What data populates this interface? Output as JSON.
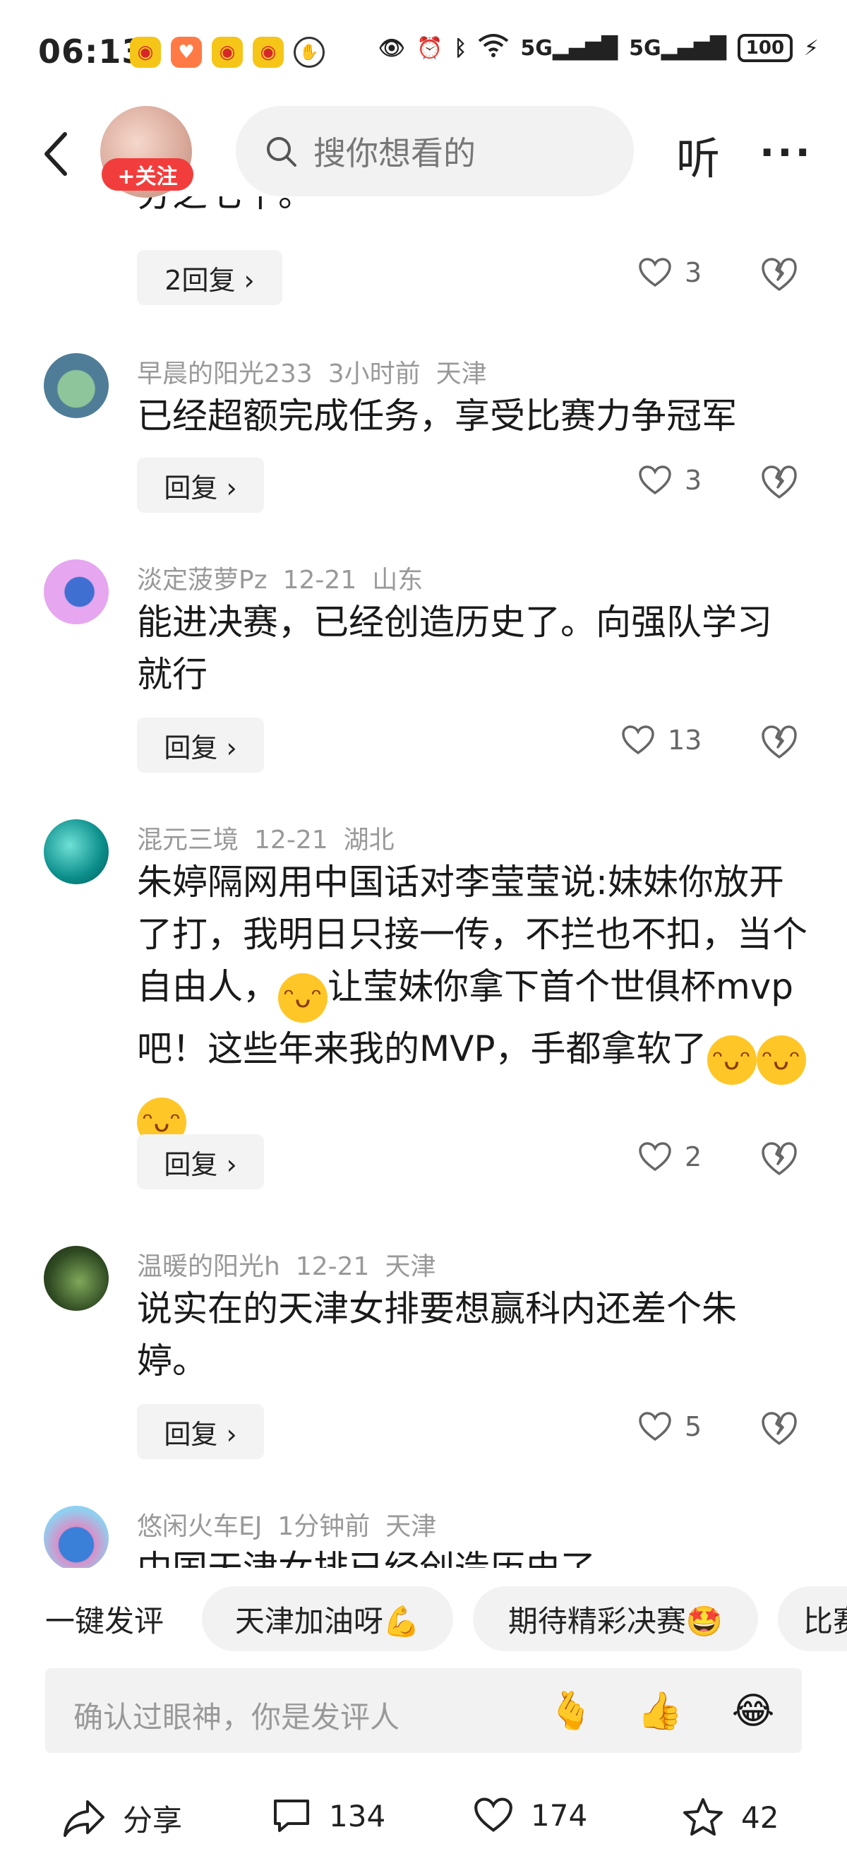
{
  "status_bar": {
    "time": "06:13",
    "network_1": "5G",
    "network_2": "5G",
    "battery": "100"
  },
  "header": {
    "follow_label": "+关注",
    "search_placeholder": "搜你想看的",
    "listen_label": "听",
    "more_label": "···"
  },
  "comments": [
    {
      "text": "分之七千。",
      "reply_label": "2回复 ›",
      "likes": "3"
    },
    {
      "user": "早晨的阳光233",
      "time": "3小时前",
      "location": "天津",
      "text": "已经超额完成任务，享受比赛力争冠军",
      "reply_label": "回复 ›",
      "likes": "3"
    },
    {
      "user": "淡定菠萝Pz",
      "time": "12-21",
      "location": "山东",
      "text": "能进决赛，已经创造历史了。向强队学习就行",
      "reply_label": "回复 ›",
      "likes": "13"
    },
    {
      "user": "混元三境",
      "time": "12-21",
      "location": "湖北",
      "text_1": "朱婷隔网用中国话对李莹莹说:妹妹你放开了打，我明日只接一传，不拦也不扣，当个自由人，",
      "text_2": "让莹妹你拿下首个世俱杯mvp吧！这些年来我的MVP，手都拿软了",
      "reply_label": "回复 ›",
      "likes": "2"
    },
    {
      "user": "温暖的阳光h",
      "time": "12-21",
      "location": "天津",
      "text": "说实在的天津女排要想赢科内还差个朱婷。",
      "reply_label": "回复 ›",
      "likes": "5"
    },
    {
      "user": "悠闲火车EJ",
      "time": "1分钟前",
      "location": "天津",
      "text": "中国天津女排已经创造历史了"
    }
  ],
  "quick_comments": {
    "label": "一键发评",
    "chips": [
      "天津加油呀💪",
      "期待精彩决赛🤩",
      "比赛"
    ]
  },
  "input": {
    "placeholder": "确认过眼神，你是发评人",
    "emojis": [
      "🫰",
      "👍",
      "😂"
    ]
  },
  "bottom_bar": {
    "share_label": "分享",
    "comment_count": "134",
    "like_count": "174",
    "favorite_count": "42"
  },
  "colors": {
    "follow_red": "#f23d3d",
    "chip_bg": "#f2f2f2",
    "meta_gray": "#999999"
  }
}
